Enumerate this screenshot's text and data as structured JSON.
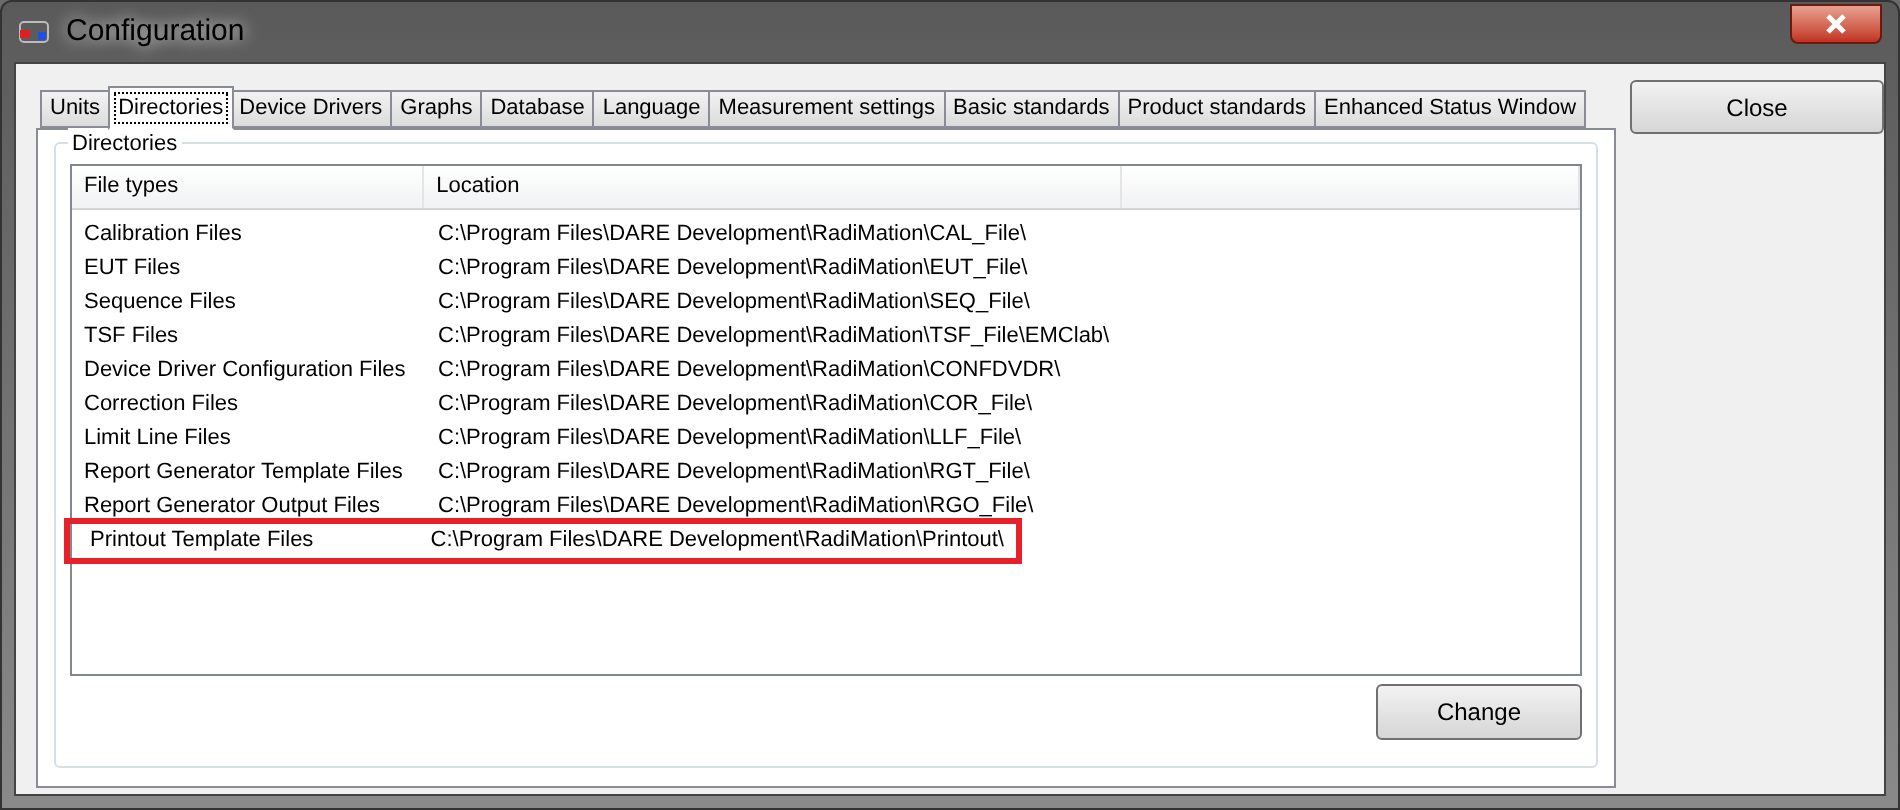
{
  "window": {
    "title": "Configuration"
  },
  "tabs": [
    {
      "label": "Units",
      "selected": false
    },
    {
      "label": "Directories",
      "selected": true
    },
    {
      "label": "Device Drivers",
      "selected": false
    },
    {
      "label": "Graphs",
      "selected": false
    },
    {
      "label": "Database",
      "selected": false
    },
    {
      "label": "Language",
      "selected": false
    },
    {
      "label": "Measurement settings",
      "selected": false
    },
    {
      "label": "Basic standards",
      "selected": false
    },
    {
      "label": "Product standards",
      "selected": false
    },
    {
      "label": "Enhanced Status Window",
      "selected": false
    }
  ],
  "group": {
    "title": "Directories"
  },
  "table": {
    "columns": [
      "File types",
      "Location"
    ],
    "rows": [
      {
        "cells": [
          "Calibration Files",
          "C:\\Program Files\\DARE Development\\RadiMation\\CAL_File\\"
        ],
        "highlighted": false
      },
      {
        "cells": [
          "EUT Files",
          "C:\\Program Files\\DARE Development\\RadiMation\\EUT_File\\"
        ],
        "highlighted": false
      },
      {
        "cells": [
          "Sequence Files",
          "C:\\Program Files\\DARE Development\\RadiMation\\SEQ_File\\"
        ],
        "highlighted": false
      },
      {
        "cells": [
          "TSF Files",
          "C:\\Program Files\\DARE Development\\RadiMation\\TSF_File\\EMClab\\"
        ],
        "highlighted": false
      },
      {
        "cells": [
          "Device Driver Configuration Files",
          "C:\\Program Files\\DARE Development\\RadiMation\\CONFDVDR\\"
        ],
        "highlighted": false
      },
      {
        "cells": [
          "Correction Files",
          "C:\\Program Files\\DARE Development\\RadiMation\\COR_File\\"
        ],
        "highlighted": false
      },
      {
        "cells": [
          "Limit Line Files",
          "C:\\Program Files\\DARE Development\\RadiMation\\LLF_File\\"
        ],
        "highlighted": false
      },
      {
        "cells": [
          "Report Generator Template Files",
          "C:\\Program Files\\DARE Development\\RadiMation\\RGT_File\\"
        ],
        "highlighted": false
      },
      {
        "cells": [
          "Report Generator Output Files",
          "C:\\Program Files\\DARE Development\\RadiMation\\RGO_File\\"
        ],
        "highlighted": false
      },
      {
        "cells": [
          "Printout Template Files",
          "C:\\Program Files\\DARE Development\\RadiMation\\Printout\\"
        ],
        "highlighted": true
      }
    ]
  },
  "buttons": {
    "change": "Change",
    "close": "Close"
  }
}
